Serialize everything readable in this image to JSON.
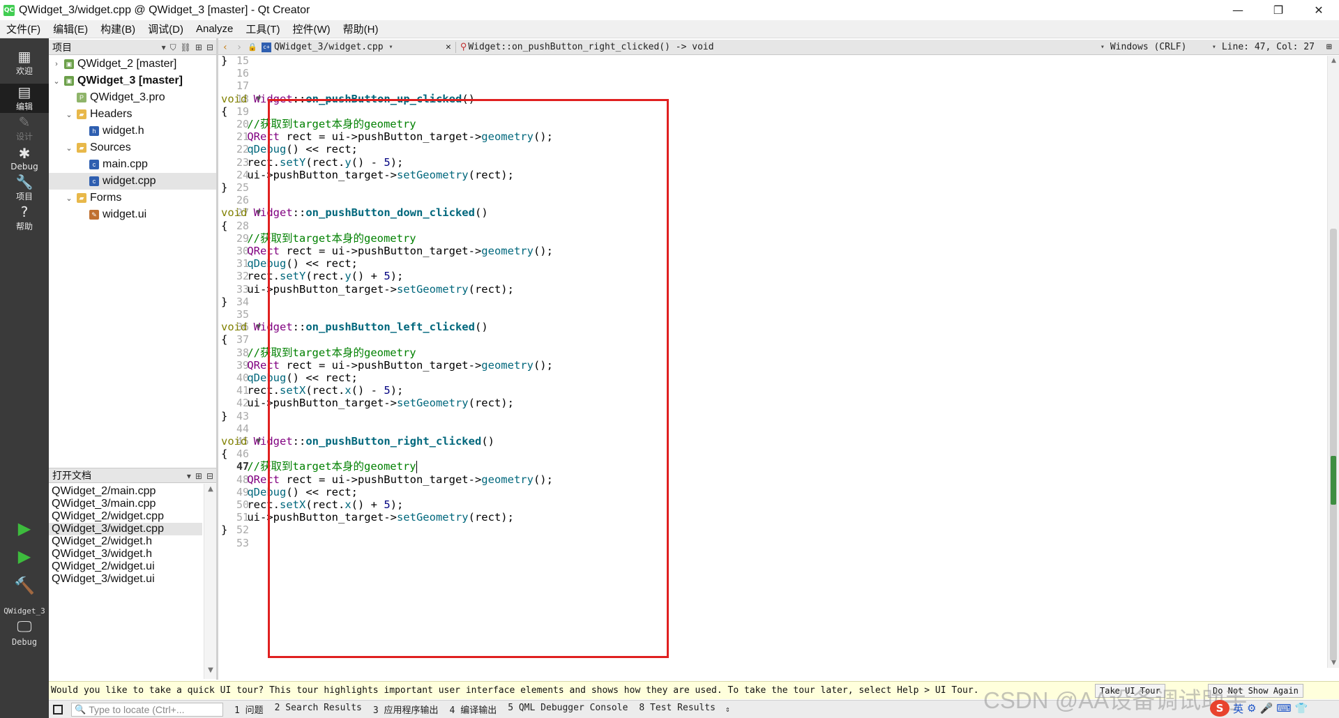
{
  "window": {
    "title": "QWidget_3/widget.cpp @ QWidget_3 [master] - Qt Creator",
    "app_icon": "QC",
    "minimize": "—",
    "restore": "❐",
    "close": "✕"
  },
  "menu": [
    "文件(F)",
    "编辑(E)",
    "构建(B)",
    "调试(D)",
    "Analyze",
    "工具(T)",
    "控件(W)",
    "帮助(H)"
  ],
  "modes": [
    {
      "label": "欢迎",
      "icon": "grid-icon",
      "glyph": "▦",
      "state": "normal"
    },
    {
      "label": "编辑",
      "icon": "edit-icon",
      "glyph": "▤",
      "state": "active"
    },
    {
      "label": "设计",
      "icon": "pencil-icon",
      "glyph": "✎",
      "state": "disabled"
    },
    {
      "label": "Debug",
      "icon": "bug-icon",
      "glyph": "✱",
      "state": "normal"
    },
    {
      "label": "项目",
      "icon": "wrench-icon",
      "glyph": "🔧",
      "state": "normal"
    },
    {
      "label": "帮助",
      "icon": "help-icon",
      "glyph": "?",
      "state": "normal"
    }
  ],
  "run_target": {
    "kit": "QWidget_3",
    "config": "Debug"
  },
  "project_pane": {
    "title": "项目",
    "tree": [
      {
        "label": "QWidget_2 [master]",
        "expander": "›",
        "icon": "project-icon",
        "depth": 0,
        "bold": false
      },
      {
        "label": "QWidget_3 [master]",
        "expander": "⌄",
        "icon": "project-icon",
        "depth": 0,
        "bold": true
      },
      {
        "label": "QWidget_3.pro",
        "expander": "",
        "icon": "pro-file-icon",
        "depth": 1,
        "bold": false
      },
      {
        "label": "Headers",
        "expander": "⌄",
        "icon": "folder-icon",
        "depth": 1,
        "bold": false
      },
      {
        "label": "widget.h",
        "expander": "",
        "icon": "header-file-icon",
        "depth": 2,
        "bold": false
      },
      {
        "label": "Sources",
        "expander": "⌄",
        "icon": "folder-icon",
        "depth": 1,
        "bold": false
      },
      {
        "label": "main.cpp",
        "expander": "",
        "icon": "cpp-file-icon",
        "depth": 2,
        "bold": false
      },
      {
        "label": "widget.cpp",
        "expander": "",
        "icon": "cpp-file-icon",
        "depth": 2,
        "bold": false,
        "selected": true
      },
      {
        "label": "Forms",
        "expander": "⌄",
        "icon": "folder-icon",
        "depth": 1,
        "bold": false
      },
      {
        "label": "widget.ui",
        "expander": "",
        "icon": "ui-file-icon",
        "depth": 2,
        "bold": false
      }
    ]
  },
  "open_documents": {
    "title": "打开文档",
    "items": [
      "QWidget_2/main.cpp",
      "QWidget_3/main.cpp",
      "QWidget_2/widget.cpp",
      "QWidget_3/widget.cpp",
      "QWidget_2/widget.h",
      "QWidget_3/widget.h",
      "QWidget_2/widget.ui",
      "QWidget_3/widget.ui"
    ],
    "selected_index": 3
  },
  "editor_toolbar": {
    "file": "QWidget_3/widget.cpp",
    "symbol": "Widget::on_pushButton_right_clicked() -> void",
    "line_ending": "Windows (CRLF)",
    "position": "Line: 47, Col: 27"
  },
  "editor": {
    "current_line": 47,
    "fold_lines": [
      18,
      27,
      36,
      45
    ],
    "lines": [
      {
        "n": 15,
        "t": [
          [
            "op",
            "}"
          ]
        ]
      },
      {
        "n": 16,
        "t": []
      },
      {
        "n": 17,
        "t": []
      },
      {
        "n": 18,
        "t": [
          [
            "kw",
            "void"
          ],
          [
            "op",
            " "
          ],
          [
            "ty",
            "Widget"
          ],
          [
            "op",
            "::"
          ],
          [
            "fn",
            "on_pushButton_up_clicked"
          ],
          [
            "op",
            "()"
          ]
        ]
      },
      {
        "n": 19,
        "t": [
          [
            "op",
            "{"
          ]
        ]
      },
      {
        "n": 20,
        "t": [
          [
            "op",
            "    "
          ],
          [
            "cm",
            "//获取到target本身的geometry"
          ]
        ]
      },
      {
        "n": 21,
        "t": [
          [
            "op",
            "    "
          ],
          [
            "ty",
            "QRect"
          ],
          [
            "op",
            " rect = ui->pushButton_target->"
          ],
          [
            "me",
            "geometry"
          ],
          [
            "op",
            "();"
          ]
        ]
      },
      {
        "n": 22,
        "t": [
          [
            "op",
            "    "
          ],
          [
            "me",
            "qDebug"
          ],
          [
            "op",
            "() << rect;"
          ]
        ]
      },
      {
        "n": 23,
        "t": [
          [
            "op",
            "    rect."
          ],
          [
            "me",
            "setY"
          ],
          [
            "op",
            "(rect."
          ],
          [
            "me",
            "y"
          ],
          [
            "op",
            "() - "
          ],
          [
            "nu",
            "5"
          ],
          [
            "op",
            ");"
          ]
        ]
      },
      {
        "n": 24,
        "t": [
          [
            "op",
            "    ui->pushButton_target->"
          ],
          [
            "me",
            "setGeometry"
          ],
          [
            "op",
            "(rect);"
          ]
        ]
      },
      {
        "n": 25,
        "t": [
          [
            "op",
            "}"
          ]
        ]
      },
      {
        "n": 26,
        "t": []
      },
      {
        "n": 27,
        "t": [
          [
            "kw",
            "void"
          ],
          [
            "op",
            " "
          ],
          [
            "ty",
            "Widget"
          ],
          [
            "op",
            "::"
          ],
          [
            "fn",
            "on_pushButton_down_clicked"
          ],
          [
            "op",
            "()"
          ]
        ]
      },
      {
        "n": 28,
        "t": [
          [
            "op",
            "{"
          ]
        ]
      },
      {
        "n": 29,
        "t": [
          [
            "op",
            "    "
          ],
          [
            "cm",
            "//获取到target本身的geometry"
          ]
        ]
      },
      {
        "n": 30,
        "t": [
          [
            "op",
            "    "
          ],
          [
            "ty",
            "QRect"
          ],
          [
            "op",
            " rect = ui->pushButton_target->"
          ],
          [
            "me",
            "geometry"
          ],
          [
            "op",
            "();"
          ]
        ]
      },
      {
        "n": 31,
        "t": [
          [
            "op",
            "    "
          ],
          [
            "me",
            "qDebug"
          ],
          [
            "op",
            "() << rect;"
          ]
        ]
      },
      {
        "n": 32,
        "t": [
          [
            "op",
            "    rect."
          ],
          [
            "me",
            "setY"
          ],
          [
            "op",
            "(rect."
          ],
          [
            "me",
            "y"
          ],
          [
            "op",
            "() + "
          ],
          [
            "nu",
            "5"
          ],
          [
            "op",
            ");"
          ]
        ]
      },
      {
        "n": 33,
        "t": [
          [
            "op",
            "    ui->pushButton_target->"
          ],
          [
            "me",
            "setGeometry"
          ],
          [
            "op",
            "(rect);"
          ]
        ]
      },
      {
        "n": 34,
        "t": [
          [
            "op",
            "}"
          ]
        ]
      },
      {
        "n": 35,
        "t": []
      },
      {
        "n": 36,
        "t": [
          [
            "kw",
            "void"
          ],
          [
            "op",
            " "
          ],
          [
            "ty",
            "Widget"
          ],
          [
            "op",
            "::"
          ],
          [
            "fn",
            "on_pushButton_left_clicked"
          ],
          [
            "op",
            "()"
          ]
        ]
      },
      {
        "n": 37,
        "t": [
          [
            "op",
            "{"
          ]
        ]
      },
      {
        "n": 38,
        "t": [
          [
            "op",
            "    "
          ],
          [
            "cm",
            "//获取到target本身的geometry"
          ]
        ]
      },
      {
        "n": 39,
        "t": [
          [
            "op",
            "    "
          ],
          [
            "ty",
            "QRect"
          ],
          [
            "op",
            " rect = ui->pushButton_target->"
          ],
          [
            "me",
            "geometry"
          ],
          [
            "op",
            "();"
          ]
        ]
      },
      {
        "n": 40,
        "t": [
          [
            "op",
            "    "
          ],
          [
            "me",
            "qDebug"
          ],
          [
            "op",
            "() << rect;"
          ]
        ]
      },
      {
        "n": 41,
        "t": [
          [
            "op",
            "    rect."
          ],
          [
            "me",
            "setX"
          ],
          [
            "op",
            "(rect."
          ],
          [
            "me",
            "x"
          ],
          [
            "op",
            "() - "
          ],
          [
            "nu",
            "5"
          ],
          [
            "op",
            ");"
          ]
        ]
      },
      {
        "n": 42,
        "t": [
          [
            "op",
            "    ui->pushButton_target->"
          ],
          [
            "me",
            "setGeometry"
          ],
          [
            "op",
            "(rect);"
          ]
        ]
      },
      {
        "n": 43,
        "t": [
          [
            "op",
            "}"
          ]
        ]
      },
      {
        "n": 44,
        "t": []
      },
      {
        "n": 45,
        "t": [
          [
            "kw",
            "void"
          ],
          [
            "op",
            " "
          ],
          [
            "ty",
            "Widget"
          ],
          [
            "op",
            "::"
          ],
          [
            "fn",
            "on_pushButton_right_clicked"
          ],
          [
            "op",
            "()"
          ]
        ]
      },
      {
        "n": 46,
        "t": [
          [
            "op",
            "{"
          ]
        ]
      },
      {
        "n": 47,
        "t": [
          [
            "op",
            "    "
          ],
          [
            "cm",
            "//获取到target本身的geometry"
          ]
        ],
        "cursor": true
      },
      {
        "n": 48,
        "t": [
          [
            "op",
            "    "
          ],
          [
            "ty",
            "QRect"
          ],
          [
            "op",
            " rect = ui->pushButton_target->"
          ],
          [
            "me",
            "geometry"
          ],
          [
            "op",
            "();"
          ]
        ]
      },
      {
        "n": 49,
        "t": [
          [
            "op",
            "    "
          ],
          [
            "me",
            "qDebug"
          ],
          [
            "op",
            "() << rect;"
          ]
        ]
      },
      {
        "n": 50,
        "t": [
          [
            "op",
            "    rect."
          ],
          [
            "me",
            "setX"
          ],
          [
            "op",
            "(rect."
          ],
          [
            "me",
            "x"
          ],
          [
            "op",
            "() + "
          ],
          [
            "nu",
            "5"
          ],
          [
            "op",
            ");"
          ]
        ]
      },
      {
        "n": 51,
        "t": [
          [
            "op",
            "    ui->pushButton_target->"
          ],
          [
            "me",
            "setGeometry"
          ],
          [
            "op",
            "(rect);"
          ]
        ]
      },
      {
        "n": 52,
        "t": [
          [
            "op",
            "}"
          ]
        ]
      },
      {
        "n": 53,
        "t": []
      }
    ]
  },
  "tour_bar": {
    "text": "Would you like to take a quick UI tour? This tour highlights important user interface elements and shows how they are used. To take the tour later, select Help > UI Tour.",
    "take_tour": "Take UI Tour",
    "dont_show": "Do Not Show Again"
  },
  "statusbar": {
    "locator_placeholder": "Type to locate (Ctrl+...",
    "panes": [
      "1 问题",
      "2 Search Results",
      "3 应用程序输出",
      "4 编译输出",
      "5 QML Debugger Console",
      "8 Test Results"
    ],
    "more": "⇕"
  },
  "watermark": "CSDN @AA设备调试助手",
  "ime": {
    "logo": "S",
    "items": [
      "英",
      "⚙",
      "🎤",
      "⌨",
      "👕"
    ]
  },
  "colors": {
    "highlight_box": "#e02020",
    "mode_bar": "#3a3a3a",
    "keyword": "#808000",
    "type": "#800080",
    "function": "#00677c",
    "comment": "#008000"
  }
}
